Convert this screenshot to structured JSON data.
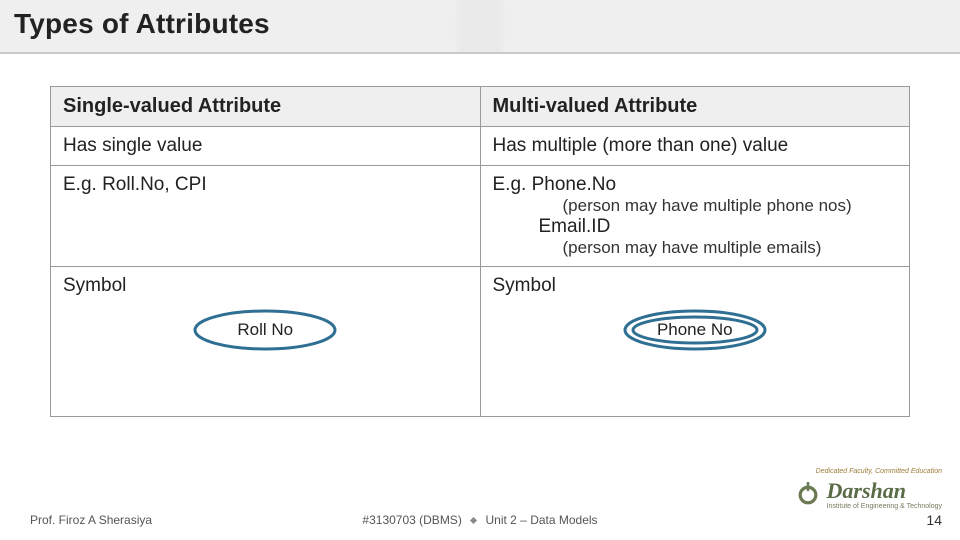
{
  "title": "Types of Attributes",
  "table": {
    "headers": {
      "left": "Single-valued Attribute",
      "right": "Multi-valued Attribute"
    },
    "row1": {
      "left": "Has single value",
      "right": "Has multiple (more than one) value"
    },
    "row2": {
      "left": "E.g. Roll.No, CPI",
      "right_line1": "E.g. Phone.No",
      "right_note1": "(person may have multiple phone nos)",
      "right_line2": "Email.ID",
      "right_note2": "(person may have multiple emails)"
    },
    "row3": {
      "left_label": "Symbol",
      "right_label": "Symbol",
      "left_shape_text": "Roll No",
      "right_shape_text": "Phone No"
    }
  },
  "footer": {
    "author": "Prof. Firoz A Sherasiya",
    "course_code": "#3130703 (DBMS)",
    "unit": "Unit 2 – Data Models",
    "page": "14"
  },
  "brand": {
    "name": "Darshan",
    "subtitle": "Institute of Engineering & Technology",
    "tagline": "Dedicated Faculty, Committed Education"
  },
  "colors": {
    "ellipse_stroke": "#2f6f93"
  }
}
